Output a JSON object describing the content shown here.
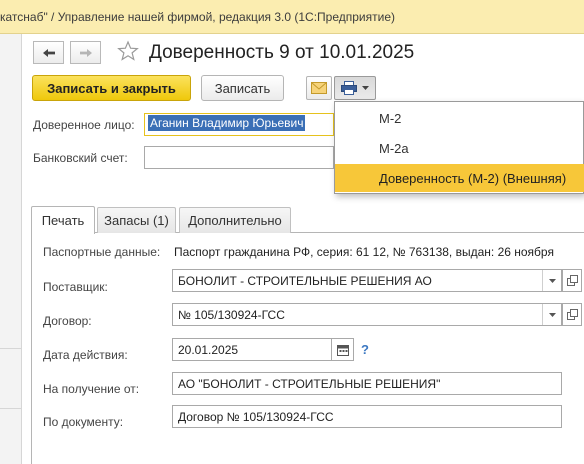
{
  "window": {
    "title": "катснаб\" / Управление нашей фирмой, редакция 3.0  (1С:Предприятие)"
  },
  "document": {
    "title": "Доверенность 9 от 10.01.2025"
  },
  "toolbar": {
    "save_close_label": "Записать и закрыть",
    "save_label": "Записать"
  },
  "header_fields": {
    "trusted_person_label": "Доверенное лицо:",
    "trusted_person_value": "Аганин Владимир Юрьевич",
    "bank_account_label": "Банковский счет:",
    "bank_account_value": ""
  },
  "print_menu": {
    "items": [
      {
        "label": "М-2",
        "highlighted": false
      },
      {
        "label": "М-2а",
        "highlighted": false
      },
      {
        "label": "Доверенность (М-2) (Внешняя)",
        "highlighted": true
      }
    ]
  },
  "tabs": [
    {
      "label": "Печать",
      "active": true
    },
    {
      "label": "Запасы (1)",
      "active": false
    },
    {
      "label": "Дополнительно",
      "active": false
    }
  ],
  "print_tab": {
    "passport_label": "Паспортные данные:",
    "passport_value": "Паспорт гражданина РФ, серия: 61 12, № 763138, выдан: 26 ноября",
    "supplier_label": "Поставщик:",
    "supplier_value": "БОНОЛИТ - СТРОИТЕЛЬНЫЕ РЕШЕНИЯ АО",
    "contract_label": "Договор:",
    "contract_value": "№ 105/130924-ГСС",
    "valid_date_label": "Дата действия:",
    "valid_date_value": "20.01.2025",
    "receive_from_label": "На получение от:",
    "receive_from_value": "АО \"БОНОЛИТ - СТРОИТЕЛЬНЫЕ РЕШЕНИЯ\"",
    "by_document_label": "По документу:",
    "by_document_value": "Договор № 105/130924-ГСС",
    "help_mark": "?"
  },
  "colors": {
    "titlebar_bg": "#fbedb0",
    "primary_button": "#f2cd1e",
    "menu_highlight": "#f7c739",
    "selection": "#3a6fb6",
    "focus_border": "#e6c21d",
    "help_blue": "#3c78c2"
  },
  "icons": {
    "back": "arrow-left-icon",
    "forward": "arrow-right-icon",
    "favorite": "star-icon",
    "email": "envelope-icon",
    "print": "printer-icon",
    "dropdown": "triangle-down-icon",
    "open": "open-window-icon",
    "calendar": "calendar-icon"
  }
}
